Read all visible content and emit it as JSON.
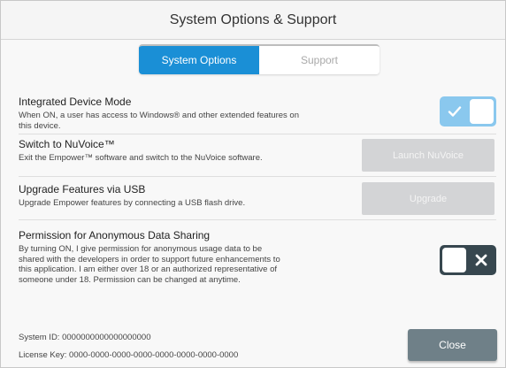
{
  "window": {
    "title": "System Options & Support"
  },
  "tabs": [
    {
      "label": "System Options",
      "active": true
    },
    {
      "label": "Support",
      "active": false
    }
  ],
  "settings": {
    "integrated_mode": {
      "title": "Integrated Device Mode",
      "description": "When ON, a user has access to Windows® and other extended features on this device.",
      "toggle_state": "on",
      "toggle_icon": "check-icon"
    },
    "nuvoice": {
      "title": "Switch to NuVoice™",
      "description": "Exit the Empower™ software and switch to the NuVoice software.",
      "button_label": "Launch NuVoice"
    },
    "upgrade": {
      "title": "Upgrade Features via USB",
      "description": "Upgrade Empower features by connecting a USB flash drive.",
      "button_label": "Upgrade"
    },
    "data_sharing": {
      "title": "Permission for Anonymous Data Sharing",
      "description": "By turning ON, I give permission for anonymous usage data to be shared with the developers in order to support future enhancements to this application. I am either over 18 or an authorized representative of someone under 18. Permission can be changed at anytime.",
      "toggle_state": "off",
      "toggle_icon": "x-icon"
    }
  },
  "footer": {
    "system_id": "System ID: 0000000000000000000",
    "license_key": "License Key: 0000-0000-0000-0000-0000-0000-0000-0000",
    "close_label": "Close"
  },
  "colors": {
    "tab_active": "#1a8fd6",
    "toggle_on": "#8ac8ee",
    "toggle_off": "#37474f",
    "disabled_button": "#d3d4d6",
    "close_button": "#6f8088"
  }
}
